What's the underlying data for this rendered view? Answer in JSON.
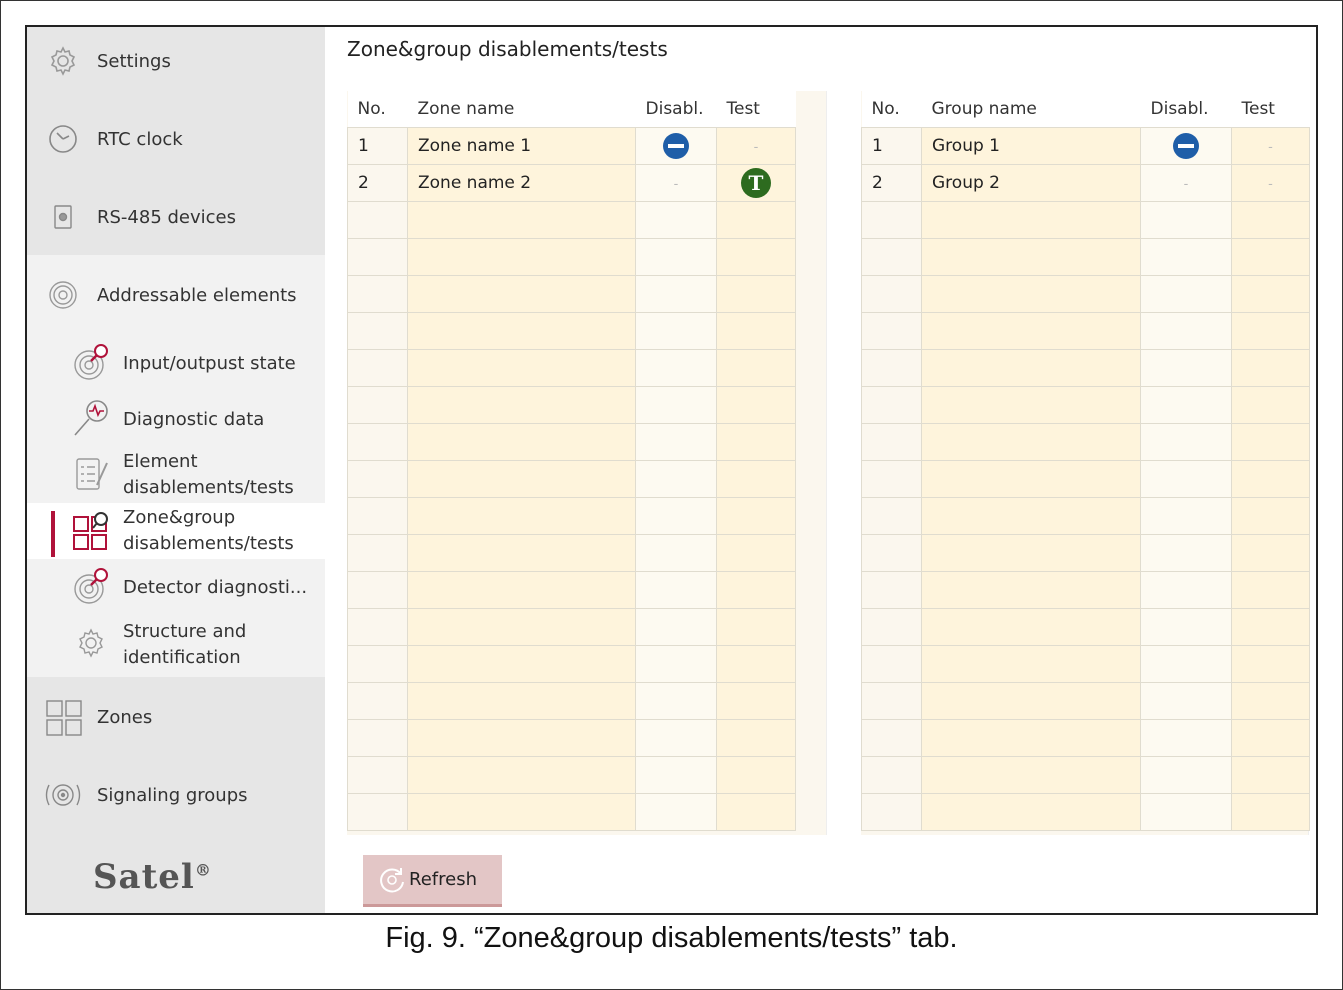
{
  "sidebar": {
    "items": [
      {
        "label": "Settings",
        "icon": "gear-icon"
      },
      {
        "label": "RTC clock",
        "icon": "clock-icon"
      },
      {
        "label": "RS-485 devices",
        "icon": "device-icon"
      },
      {
        "label": "Addressable elements",
        "icon": "detector-icon"
      },
      {
        "label": "Zones",
        "icon": "zones-grid-icon"
      },
      {
        "label": "Signaling groups",
        "icon": "signaling-icon"
      }
    ],
    "subitems": [
      {
        "label": "Input/outpust state",
        "icon": "detector-search-icon"
      },
      {
        "label": "Diagnostic data",
        "icon": "diagnostic-magnifier-icon"
      },
      {
        "label_line1": "Element",
        "label_line2": "disablements/tests",
        "icon": "checklist-icon"
      },
      {
        "label_line1": "Zone&group",
        "label_line2": "disablements/tests",
        "icon": "zone-group-search-icon",
        "active": true
      },
      {
        "label": "Detector diagnosti...",
        "icon": "detector-search-icon"
      },
      {
        "label_line1": "Structure and",
        "label_line2": "identification",
        "icon": "gear-icon"
      }
    ],
    "logo": "Satel"
  },
  "main": {
    "title": "Zone&group disablements/tests",
    "zones_table": {
      "headers": [
        "No.",
        "Zone name",
        "Disabl.",
        "Test"
      ],
      "rows": [
        {
          "no": "1",
          "name": "Zone name 1",
          "disabled": true,
          "test": false
        },
        {
          "no": "2",
          "name": "Zone name 2",
          "disabled": false,
          "test": true
        }
      ]
    },
    "groups_table": {
      "headers": [
        "No.",
        "Group name",
        "Disabl.",
        "Test"
      ],
      "rows": [
        {
          "no": "1",
          "name": "Group 1",
          "disabled": true,
          "test": false
        },
        {
          "no": "2",
          "name": "Group 2",
          "disabled": false,
          "test": false
        }
      ]
    },
    "dash": "-",
    "test_glyph": "T",
    "refresh_label": "Refresh"
  },
  "caption": "Fig. 9. “Zone&group disablements/tests” tab.",
  "colors": {
    "active_marker": "#b0123a",
    "disabled_icon": "#1f5ea8",
    "test_icon": "#2d6b1f"
  }
}
